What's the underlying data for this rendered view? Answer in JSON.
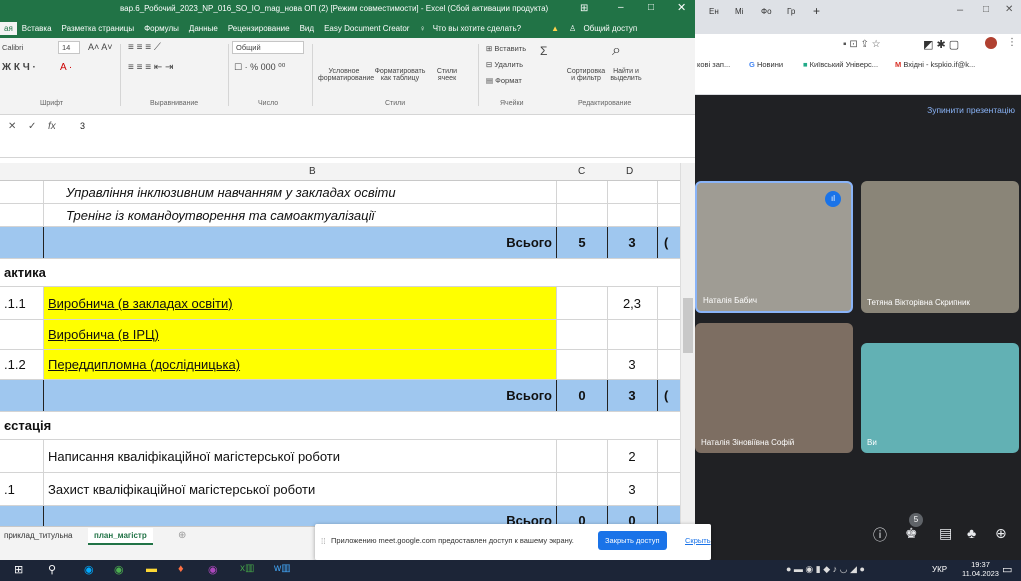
{
  "excel": {
    "title": "вар.6_Робочий_2023_NP_016_SO_IO_mag_нова ОП (2) [Режим совместимости] - Excel (Сбой активации продукта)",
    "menu": [
      "ая",
      "Вставка",
      "Разметка страницы",
      "Формулы",
      "Данные",
      "Рецензирование",
      "Вид",
      "Easy Document Creator"
    ],
    "tellme": "Что вы хотите сделать?",
    "share": "Общий доступ",
    "font": {
      "name": "Calibri",
      "size": "14",
      "label_font": "Шрифт",
      "label_align": "Выравнивание",
      "label_number": "Число",
      "label_styles": "Стили",
      "label_cells": "Ячейки",
      "label_edit": "Редактирование"
    },
    "number_format": "Общий",
    "styles": {
      "cond": "Условное форматирование",
      "table": "Форматировать как таблицу",
      "cellstyles": "Стили ячеек"
    },
    "cells": {
      "insert": "Вставить",
      "delete": "Удалить",
      "format": "Формат"
    },
    "edit": {
      "sort": "Сортировка и фильтр",
      "find": "Найти и выделить"
    },
    "formula": {
      "fx": "fx",
      "value": "3"
    },
    "columns": {
      "b": "B",
      "c": "C",
      "d": "D"
    },
    "rows": [
      {
        "a": "",
        "b": "Управління інклюзивним навчанням у закладах освіти",
        "c": "",
        "d": ""
      },
      {
        "a": "",
        "b": "Тренінг із командоутворення та самоактуалізації",
        "c": "",
        "d": ""
      },
      {
        "a": "",
        "b": "Всього",
        "c": "5",
        "d": "3",
        "e": "("
      },
      {
        "a": "актика",
        "b": "",
        "c": "",
        "d": ""
      },
      {
        "a": ".1.1",
        "b": "Виробнича (в закладах освіти)",
        "c": "",
        "d": "2,3"
      },
      {
        "a": "",
        "b": "Виробнича (в ІРЦ)",
        "c": "",
        "d": ""
      },
      {
        "a": ".1.2",
        "b": "Переддипломна (дослідницька)",
        "c": "",
        "d": "3"
      },
      {
        "a": "",
        "b": "Всього",
        "c": "0",
        "d": "3",
        "e": "("
      },
      {
        "a": "єстація",
        "b": "",
        "c": "",
        "d": ""
      },
      {
        "a": "",
        "b": "Написання кваліфікаційної магістерської роботи",
        "c": "",
        "d": "2"
      },
      {
        "a": ".1",
        "b": "Захист кваліфікаційної магістерської роботи",
        "c": "",
        "d": "3"
      },
      {
        "a": "",
        "b": "Всього",
        "c": "0",
        "d": "0"
      }
    ],
    "sheets": [
      "приклад_титульна",
      "план_магістр"
    ]
  },
  "share_bar": {
    "text": "Приложению meet.google.com предоставлен доступ к вашему экрану.",
    "stop": "Закрыть доступ",
    "hide": "Скрыть"
  },
  "chrome": {
    "tabs": [
      "Ен",
      "Мі",
      "Фо",
      "Гр"
    ],
    "bookmarks": [
      "кові зап...",
      "Новини",
      "Київський Універс...",
      "Вхідні - kspkio.if@k..."
    ]
  },
  "meet": {
    "stop_presenting": "Зупинити презентацію",
    "participants": [
      {
        "name": "Наталія Бабич"
      },
      {
        "name": "Тетяна Вікторівна Скрипник"
      },
      {
        "name": "Наталія Зіновіївна Софій"
      },
      {
        "name": "Ви"
      }
    ],
    "people_count": "5"
  },
  "taskbar": {
    "lang": "УКР",
    "time": "19:37",
    "date": "11.04.2023"
  },
  "colors": {
    "excel_green": "#217346",
    "yellow": "#ffff00",
    "total_blue": "#9fc7ef",
    "meet_bg": "#202124",
    "accent": "#1a73e8"
  }
}
